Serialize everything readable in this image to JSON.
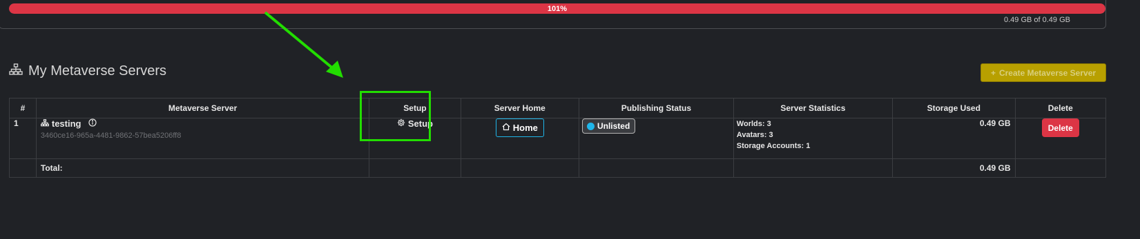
{
  "usage": {
    "percent": 1.01,
    "percent_label": "101%",
    "text": "0.49 GB of 0.49 GB",
    "fill_color": "#dc3545"
  },
  "section": {
    "title": "My Metaverse Servers",
    "icon": "network-icon"
  },
  "create_button": {
    "label": "Create Metaverse Server",
    "icon": "plus-icon"
  },
  "table": {
    "headers": [
      "#",
      "Metaverse Server",
      "Setup",
      "Server Home",
      "Publishing Status",
      "Server Statistics",
      "Storage Used",
      "Delete"
    ],
    "rows": [
      {
        "index": "1",
        "name": "testing",
        "id": "3460ce16-965a-4481-9862-57bea5206ff8",
        "setup_label": "Setup",
        "home_label": "Home",
        "status_label": "Unlisted",
        "status_color": "#1fb6ea",
        "stats": [
          "Worlds: 3",
          "Avatars: 3",
          "Storage Accounts: 1"
        ],
        "storage": "0.49 GB",
        "delete_label": "Delete"
      }
    ],
    "total": {
      "label": "Total:",
      "storage": "0.49 GB"
    }
  },
  "annotation": {
    "color": "#22dd00"
  }
}
